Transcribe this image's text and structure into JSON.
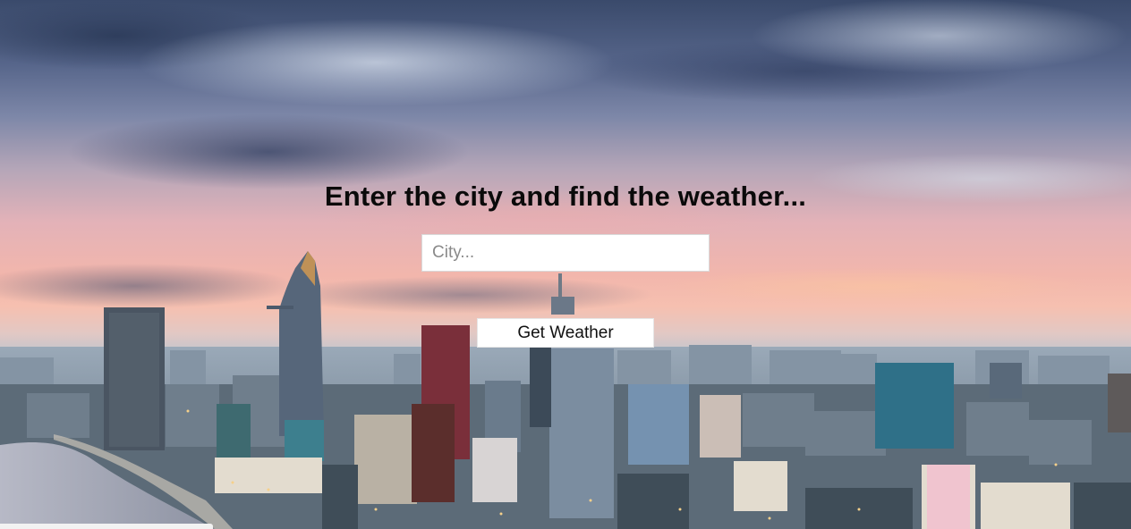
{
  "page": {
    "headline": "Enter the city and find the weather...",
    "background": "saigon-skyline-at-dusk-photo"
  },
  "search": {
    "placeholder": "City...",
    "value": ""
  },
  "actions": {
    "get_weather_label": "Get Weather"
  },
  "colors": {
    "headline": "#0a0a0a",
    "input_bg": "#ffffff",
    "button_bg": "#ffffff",
    "sky_top": "#3a4a6b",
    "sky_glow": "#f2b6ac"
  }
}
